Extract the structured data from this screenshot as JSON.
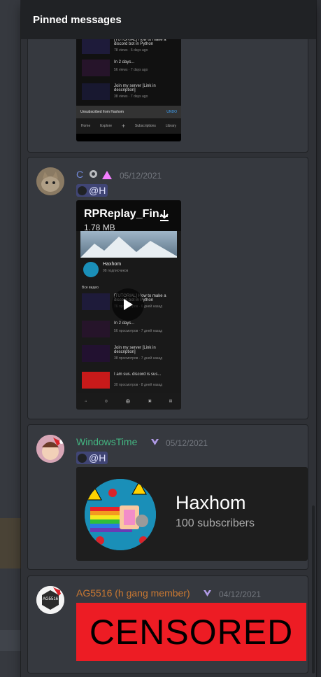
{
  "popout": {
    "title": "Pinned messages"
  },
  "colors": {
    "header_bg": "#202225",
    "card_bg": "#36393f",
    "mention_bg": "#4a4f9a",
    "green_user": "#43b581",
    "orange_user": "#c97832",
    "blue_user": "#7289da",
    "censored_bg": "#ed1c24"
  },
  "messages": [
    {
      "phone": {
        "rows": [
          {
            "title": "[TUTORIAL] How to make a discord bot in Python",
            "meta": "78 views · 6 days ago"
          },
          {
            "title": "In 2 days...",
            "meta": "56 views · 7 days ago"
          },
          {
            "title": "Join my server [Link in description]",
            "meta": "38 views · 7 days ago"
          }
        ],
        "toast": "Unsubscribed from Haxhom",
        "toast_action": "UNDO",
        "nav": [
          "Home",
          "Explore",
          "+",
          "Subscriptions",
          "Library"
        ]
      }
    },
    {
      "username": "C",
      "timestamp": "05/12/2021",
      "mention": "@H",
      "attachment": {
        "filename": "RPReplay_Fin...",
        "size": "1.78 MB"
      },
      "phone": {
        "channel": "Haxhom",
        "channel_meta": "98 подписчиков",
        "section": "Все видео",
        "rows": [
          {
            "title": "[TUTORIAL] How to make a discord bot in Python",
            "meta": "76 просмотров · 6 дней назад"
          },
          {
            "title": "In 2 days...",
            "meta": "56 просмотров · 7 дней назад"
          },
          {
            "title": "Join my server [Link in description]",
            "meta": "38 просмотров · 7 дней назад"
          },
          {
            "title": "I am sus. discord is sus...",
            "meta": "30 просмотров · 8 дней назад"
          }
        ],
        "durations": [
          "0:37",
          "0:23",
          "0:24"
        ]
      }
    },
    {
      "username": "WindowsTime",
      "timestamp": "05/12/2021",
      "mention": "@H",
      "embed": {
        "channel": "Haxhom",
        "subscribers": "100 subscribers"
      }
    },
    {
      "username": "AG5516 (h gang member)",
      "timestamp": "04/12/2021",
      "avatar_text": "AG5516",
      "censored_text": "CENSORED"
    }
  ]
}
